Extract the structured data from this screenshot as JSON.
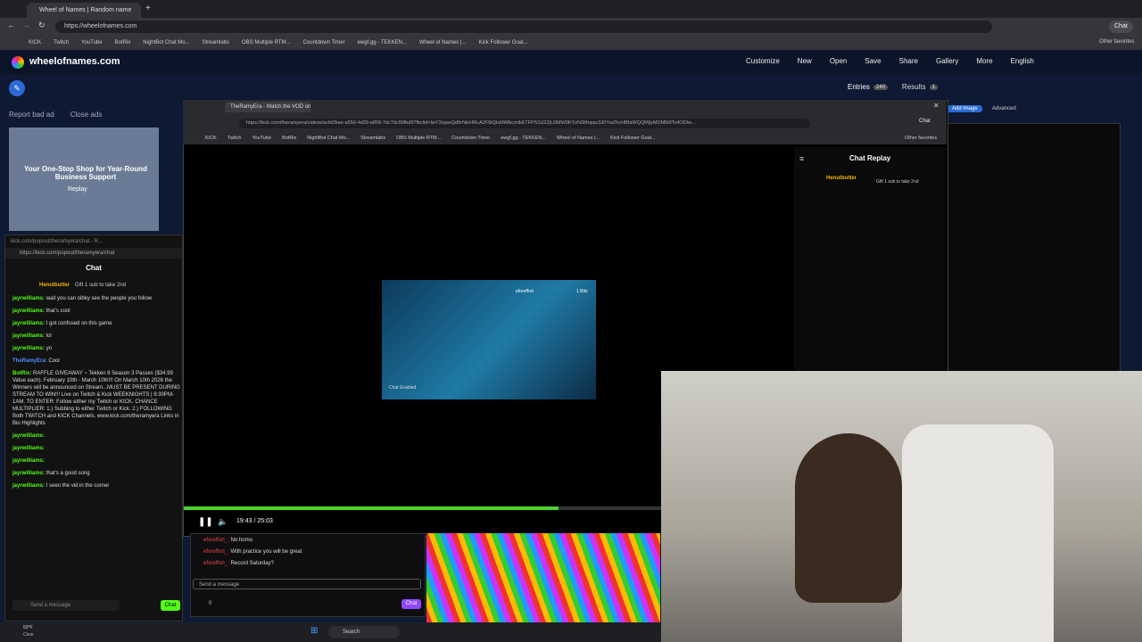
{
  "browser": {
    "tab_title": "Wheel of Names | Random name",
    "url": "https://wheelofnames.com",
    "bookmarks": [
      "KICK",
      "Twitch",
      "YouTube",
      "BotRix",
      "NightBot Chat Mo...",
      "Streamlabs",
      "OBS Multiple RTM...",
      "Countdown Timer",
      "ewgf.gg - TEKKEN...",
      "Wheel of Names |...",
      "Kick Follower Goal..."
    ],
    "other_favorites": "Other favorites",
    "chat_label": "Chat"
  },
  "site": {
    "logo": "wheelofnames.com",
    "nav": [
      "Customize",
      "New",
      "Open",
      "Save",
      "Share",
      "Gallery",
      "More",
      "English"
    ],
    "report_ad": "Report bad ad",
    "close_ads": "Close ads",
    "ad_text": "Your One-Stop Shop for Year-Round Business Support",
    "replay": "Replay",
    "entries": "Entries",
    "entries_count": "240",
    "results": "Results",
    "results_count": "1",
    "add_image": "Add image",
    "advanced": "Advanced"
  },
  "popout": {
    "url_title": "kick.com/popout/theramyera/chat - R...",
    "url": "https://kick.com/popout/theramyera/chat",
    "header": "Chat",
    "pinned_user": "Henutbutter",
    "pinned_text": "Gift 1 sub to take 2nd",
    "messages": [
      {
        "user": "jayrwilliams:",
        "text": "wait you can oibky see the people you follow"
      },
      {
        "user": "jayrwilliams:",
        "text": "that's cool"
      },
      {
        "user": "jayrwilliams:",
        "text": "I got confused on this game"
      },
      {
        "user": "jayrwilliams:",
        "text": "lol"
      },
      {
        "user": "jayrwilliams:",
        "text": "yo"
      },
      {
        "user": "TheRamyEra:",
        "text": "Cool"
      },
      {
        "user": "BotRix:",
        "text": "RAFFLE GIVEAWAY ~ Tekken 8 Season 3 Passes ($34.99 Value each). February 10th - March 10th!!! On March 10th 2026 the Winners will be announced on Stream...MUST BE PRESENT DURING STREAM TO WIN!!! Live on Twitch & Kick WEEKNIGHTS | 9:30PM-1AM. TO ENTER: Follow either my Twitch or KICK. CHANCE MULTIPLIER: 1.) Subbing to either Twitch or Kick. 2.) FOLLOWING Both TWITCH and KICK Channels. www.kick.com/theramyera Links in Bio Highlights"
      },
      {
        "user": "jayrwilliams:",
        "text": ""
      },
      {
        "user": "jayrwilliams:",
        "text": ""
      },
      {
        "user": "jayrwilliams:",
        "text": ""
      },
      {
        "user": "jayrwilliams:",
        "text": "that's a good song"
      },
      {
        "user": "jayrwilliams:",
        "text": "I seen the vid in the corner"
      }
    ],
    "send_placeholder": "Send a message",
    "chat_button": "Chat"
  },
  "inner": {
    "tab_title": "TheRamyEra - Watch the VOD on...",
    "url": "https://kick.com/theramyera/videos/ecfd2bee-a556-4d29-a858-7dc7dc99fbd9?fbclid=IwY2xjawQd5rNleHRuA2FlbQIxMABicmlkETFPS1U2ZjU3MW9KYzN3Mnpac3J0YwZhcHBfaWQQMjlyMDM5MTc4ODIw...",
    "bookmarks": [
      "KICK",
      "Twitch",
      "YouTube",
      "BotRix",
      "NightBot Chat Mo...",
      "Streamlabs",
      "OBS Multiple RTM...",
      "Countdown Timer",
      "ewgf.gg - TEKKEN...",
      "Wheel of Names |...",
      "Kick Follower Goal..."
    ],
    "other_favorites": "Other favorites",
    "chat_label": "Chat",
    "time": "19:43 / 25:03",
    "progress": 0.785,
    "chat_replay_title": "Chat Replay",
    "replay_user": "Henutbutter",
    "replay_text": "Gift 1 sub to take 2nd",
    "frame_caption": "Chat Enabled",
    "frame_user": "eforeffort",
    "frame_bits": "1 Bits"
  },
  "lower_chat": {
    "lines": [
      {
        "user": "eforeffort_:",
        "text": "No homo"
      },
      {
        "user": "eforeffort_:",
        "text": "With practice you will be great"
      },
      {
        "user": "eforeffort_:",
        "text": "Record Saturday?"
      }
    ],
    "send_placeholder": "Send a message",
    "count": "0",
    "chat_button": "Chat"
  },
  "taskbar": {
    "weather_temp": "53°F",
    "weather_desc": "Clear",
    "search": "Search"
  },
  "colors": {
    "kick_green": "#53fc18",
    "accent_blue": "#2b6ad6"
  }
}
